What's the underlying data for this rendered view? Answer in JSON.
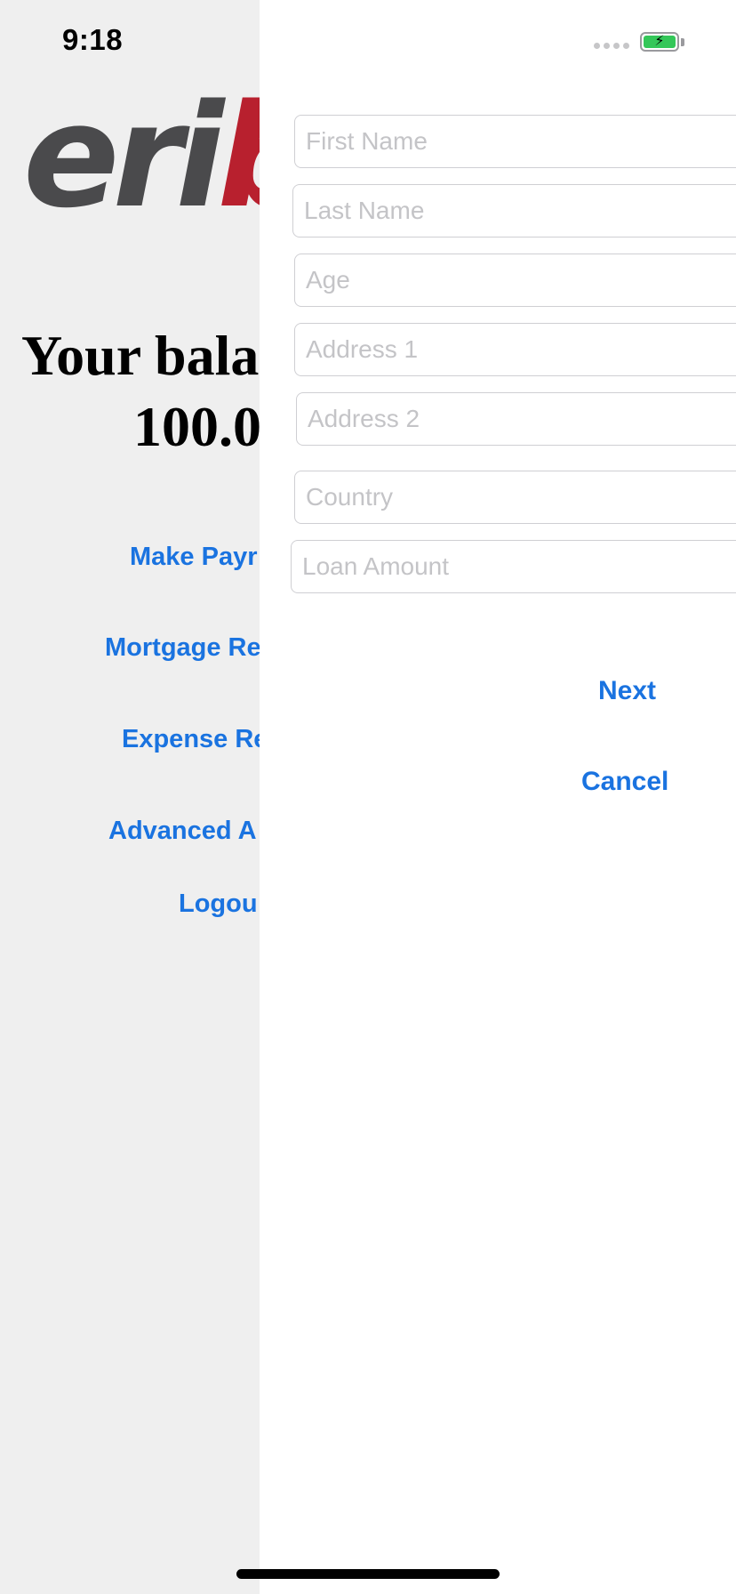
{
  "status_bar": {
    "time": "9:18",
    "battery_icon": "battery-charging-icon",
    "signal_icon": "signal-dots-icon",
    "battery_color": "#34c759"
  },
  "background_screen": {
    "logo_gray": "eri",
    "logo_red": "bc",
    "logo_colors": {
      "gray": "#4a4a4c",
      "red": "#b8202e"
    },
    "balance_label": "Your bala",
    "balance_amount": "100.0",
    "links": [
      {
        "label": "Make Payr"
      },
      {
        "label": "Mortgage Re"
      },
      {
        "label": "Expense Re"
      },
      {
        "label": "Advanced A"
      },
      {
        "label": "Logou"
      }
    ],
    "link_color": "#1a73e0"
  },
  "form": {
    "fields": [
      {
        "placeholder": "First Name",
        "value": ""
      },
      {
        "placeholder": "Last Name",
        "value": ""
      },
      {
        "placeholder": "Age",
        "value": ""
      },
      {
        "placeholder": "Address 1",
        "value": ""
      },
      {
        "placeholder": "Address 2",
        "value": ""
      },
      {
        "placeholder": "Country",
        "value": ""
      },
      {
        "placeholder": "Loan Amount",
        "value": ""
      }
    ],
    "next_label": "Next",
    "cancel_label": "Cancel"
  }
}
